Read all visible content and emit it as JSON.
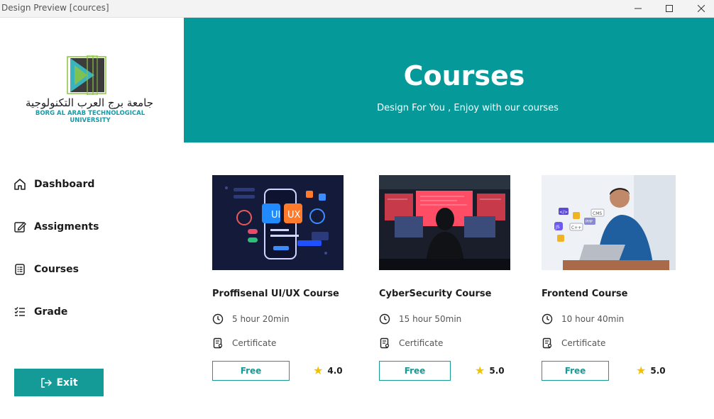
{
  "window": {
    "title": "Design Preview [cources]"
  },
  "logo": {
    "arabic": "جامعة برج العرب التكنولوجية",
    "english": "BORG AL ARAB TECHNOLOGICAL UNIVERSITY"
  },
  "sidebar": {
    "items": [
      {
        "label": "Dashboard",
        "icon": "home-icon"
      },
      {
        "label": "Assigments",
        "icon": "edit-icon"
      },
      {
        "label": "Courses",
        "icon": "courses-icon"
      },
      {
        "label": "Grade",
        "icon": "grade-list-icon"
      }
    ],
    "exit_label": "Exit"
  },
  "header": {
    "title": "Courses",
    "subtitle": "Design For You , Enjoy with our courses"
  },
  "courses": [
    {
      "title": "Proffisenal UI/UX Course",
      "duration": "5 hour 20min",
      "certificate": "Certificate",
      "price_label": "Free",
      "rating": "4.0",
      "image": "ui-ux-illustration",
      "thumb_text": {
        "ui": "UI",
        "ux": "UX"
      }
    },
    {
      "title": "CyberSecurity Course",
      "duration": "15 hour 50min",
      "certificate": "Certificate",
      "price_label": "Free",
      "rating": "5.0",
      "image": "hacker-photo"
    },
    {
      "title": "Frontend Course",
      "duration": "10 hour 40min",
      "certificate": "Certificate",
      "price_label": "Free",
      "rating": "5.0",
      "image": "developer-photo",
      "thumb_text": {
        "t1": "</>",
        "t2": "CMS",
        "t3": "JS",
        "t4": "C++",
        "t5": "PHP"
      }
    }
  ],
  "colors": {
    "accent": "#06999a",
    "button": "#149b98",
    "star": "#f2c200"
  }
}
